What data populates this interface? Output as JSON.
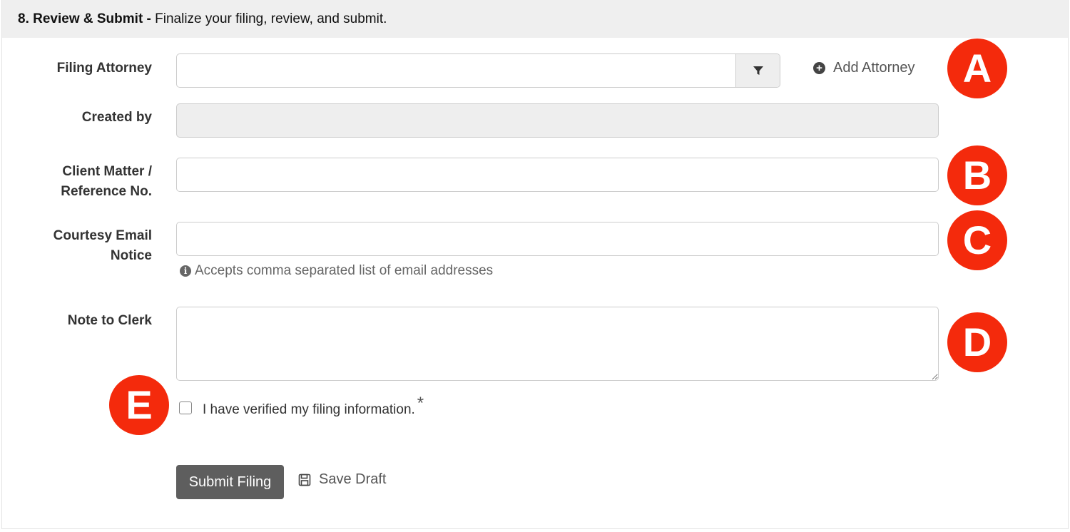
{
  "header": {
    "step": "8. Review & Submit -",
    "description": "Finalize your filing, review, and submit."
  },
  "fields": {
    "filing_attorney": {
      "label": "Filing Attorney",
      "value": "",
      "placeholder": ""
    },
    "created_by": {
      "label": "Created by",
      "value": ""
    },
    "client_matter": {
      "label_line1": "Client Matter /",
      "label_line2": "Reference No.",
      "value": ""
    },
    "courtesy_email": {
      "label_line1": "Courtesy Email",
      "label_line2": "Notice",
      "value": "",
      "help": "Accepts comma separated list of email addresses"
    },
    "note_to_clerk": {
      "label": "Note to Clerk",
      "value": ""
    }
  },
  "actions": {
    "add_attorney": "Add Attorney",
    "submit": "Submit Filing",
    "save_draft": "Save Draft"
  },
  "verify": {
    "label": "I have verified my filing information.",
    "required_mark": "*",
    "checked": false
  },
  "callouts": {
    "a": "A",
    "b": "B",
    "c": "C",
    "d": "D",
    "e": "E",
    "color": "#f42a0c"
  },
  "icons": {
    "filter": "filter-icon",
    "add": "plus-circle-icon",
    "info": "info-circle-icon",
    "save": "floppy-disk-icon"
  }
}
